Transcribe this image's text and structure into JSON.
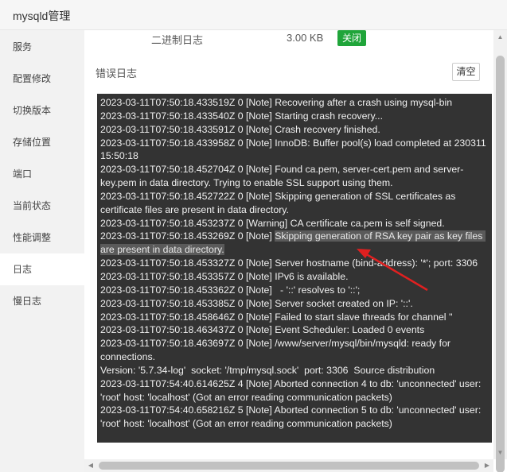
{
  "window": {
    "title": "mysqld管理"
  },
  "sidebar": {
    "items": [
      {
        "label": "服务"
      },
      {
        "label": "配置修改"
      },
      {
        "label": "切换版本"
      },
      {
        "label": "存储位置"
      },
      {
        "label": "端口"
      },
      {
        "label": "当前状态"
      },
      {
        "label": "性能调整"
      },
      {
        "label": "日志",
        "active": true
      },
      {
        "label": "慢日志"
      }
    ]
  },
  "binlog": {
    "label": "二进制日志",
    "size": "3.00 KB",
    "toggle_label": "关闭"
  },
  "errlog": {
    "title": "错误日志",
    "clear_label": "清空",
    "lines": [
      "2023-03-11T07:50:18.433519Z 0 [Note] Recovering after a crash using mysql-bin",
      "2023-03-11T07:50:18.433540Z 0 [Note] Starting crash recovery...",
      "2023-03-11T07:50:18.433591Z 0 [Note] Crash recovery finished.",
      "2023-03-11T07:50:18.433958Z 0 [Note] InnoDB: Buffer pool(s) load completed at 230311 15:50:18",
      "2023-03-11T07:50:18.452704Z 0 [Note] Found ca.pem, server-cert.pem and server-key.pem in data directory. Trying to enable SSL support using them.",
      "2023-03-11T07:50:18.452722Z 0 [Note] Skipping generation of SSL certificates as certificate files are present in data directory.",
      "2023-03-11T07:50:18.453237Z 0 [Warning] CA certificate ca.pem is self signed.",
      "2023-03-11T07:50:18.453327Z 0 [Note] Server hostname (bind-address): '*'; port: 3306",
      "2023-03-11T07:50:18.453357Z 0 [Note] IPv6 is available.",
      "2023-03-11T07:50:18.453362Z 0 [Note]   - '::' resolves to '::';",
      "2023-03-11T07:50:18.453385Z 0 [Note] Server socket created on IP: '::'.",
      "2023-03-11T07:50:18.458646Z 0 [Note] Failed to start slave threads for channel ''",
      "2023-03-11T07:50:18.463437Z 0 [Note] Event Scheduler: Loaded 0 events",
      "2023-03-11T07:50:18.463697Z 0 [Note] /www/server/mysql/bin/mysqld: ready for connections.",
      "Version: '5.7.34-log'  socket: '/tmp/mysql.sock'  port: 3306  Source distribution",
      "2023-03-11T07:54:40.614625Z 4 [Note] Aborted connection 4 to db: 'unconnected' user: 'root' host: 'localhost' (Got an error reading communication packets)",
      "2023-03-11T07:54:40.658216Z 5 [Note] Aborted connection 5 to db: 'unconnected' user: 'root' host: 'localhost' (Got an error reading communication packets)"
    ],
    "highlighted_line": {
      "prefix": "2023-03-11T07:50:18.453269Z 0 [Note] ",
      "text": "Skipping generation of RSA key pair as key files are present in data directory."
    }
  },
  "colors": {
    "accent_green": "#20a53a",
    "log_background": "#333333",
    "annotation_arrow": "#e02020"
  }
}
